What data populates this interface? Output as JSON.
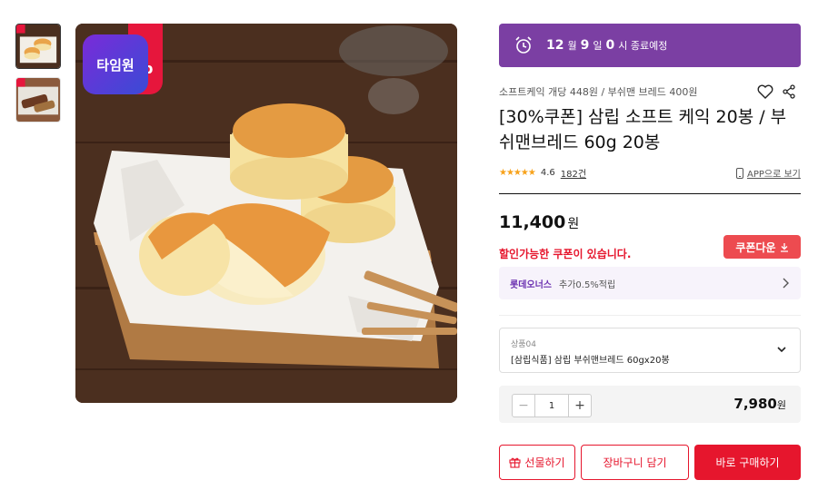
{
  "gallery": {
    "thumbnails": [
      "thumbnail-1",
      "thumbnail-2"
    ],
    "badge": {
      "text": "타임원",
      "corner_letter": "p"
    }
  },
  "timer": {
    "month": "12",
    "month_unit": "월",
    "day": "9",
    "day_unit": "일",
    "hour": "0",
    "hour_unit": "시 종료예정"
  },
  "product": {
    "subtitle": "소프트케익 개당 448원 / 부쉬맨 브레드 400원",
    "title": "[30%쿠폰] 삼립 소프트 케익 20봉 / 부쉬맨브레드 60g 20봉",
    "rating": "4.6",
    "review_count": "182건",
    "app_view": "APP으로 보기",
    "price": "11,400",
    "price_unit": "원"
  },
  "coupon": {
    "notice": "할인가능한 쿠폰이 있습니다.",
    "button": "쿠폰다운"
  },
  "points": {
    "name": "롯데오너스",
    "value": "추가0.5%적립"
  },
  "option": {
    "label": "상품04",
    "value": "[삼립식품] 삼립 부쉬맨브레드 60gx20봉"
  },
  "quantity": {
    "value": "1",
    "minus": "−",
    "plus": "+",
    "total": "7,980",
    "total_unit": "원"
  },
  "actions": {
    "gift": "선물하기",
    "cart": "장바구니 담기",
    "buy": "바로 구매하기"
  },
  "colors": {
    "accent_red": "#e6162d",
    "timer_purple": "#7b3fa3",
    "star": "#f7a21b"
  }
}
